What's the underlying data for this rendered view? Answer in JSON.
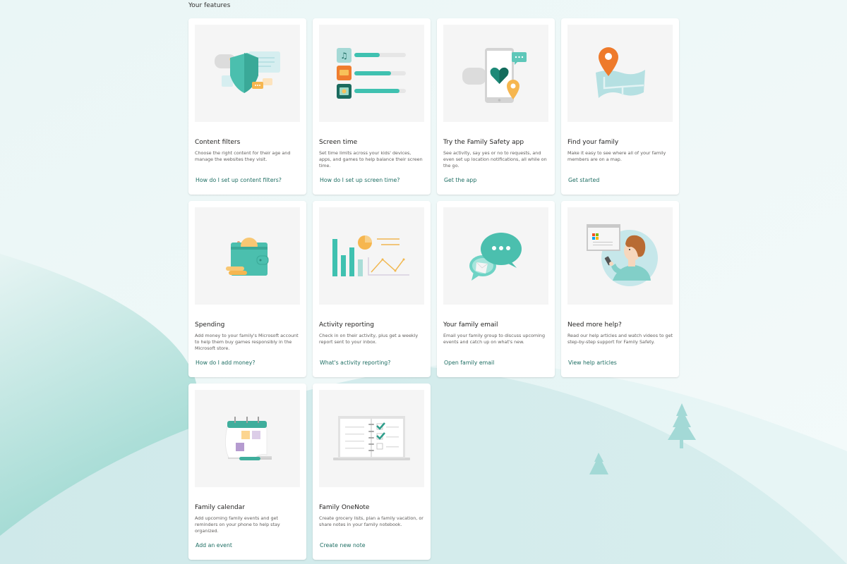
{
  "section_title": "Your features",
  "colors": {
    "accent_teal": "#3fc1b0",
    "link": "#1e6e63",
    "orange": "#f07c2a",
    "yellow": "#f8c25a",
    "background": "#eef7f7"
  },
  "features": [
    {
      "title": "Content filters",
      "description": "Choose the right content for their age and manage the websites they visit.",
      "link": "How do I set up content filters?",
      "illustration": "shield-icon"
    },
    {
      "title": "Screen time",
      "description": "Set time limits across your kids' devices, apps, and games to help balance their screen time.",
      "link": "How do I set up screen time?",
      "illustration": "screen-time-bars-icon"
    },
    {
      "title": "Try the Family Safety app",
      "description": "See activity, say yes or no to requests, and even set up location notifications, all while on the go.",
      "link": "Get the app",
      "illustration": "phone-heart-icon"
    },
    {
      "title": "Find your family",
      "description": "Make it easy to see where all of your family members are on a map.",
      "link": "Get started",
      "illustration": "map-pin-icon"
    },
    {
      "title": "Spending",
      "description": "Add money to your family's Microsoft account to help them buy games responsibly in the Microsoft store.",
      "link": "How do I add money?",
      "illustration": "wallet-icon"
    },
    {
      "title": "Activity reporting",
      "description": "Check in on their activity, plus get a weekly report sent to your inbox.",
      "link": "What's activity reporting?",
      "illustration": "chart-report-icon"
    },
    {
      "title": "Your family email",
      "description": "Email your family group to discuss upcoming events and catch up on what's new.",
      "link": "Open family email",
      "illustration": "chat-email-icon"
    },
    {
      "title": "Need more help?",
      "description": "Read our help articles and watch videos to get step-by-step support for Family Safety.",
      "link": "View help articles",
      "illustration": "help-person-icon"
    },
    {
      "title": "Family calendar",
      "description": "Add upcoming family events and get reminders on your phone to help stay organized.",
      "link": "Add an event",
      "illustration": "calendar-icon"
    },
    {
      "title": "Family OneNote",
      "description": "Create grocery lists, plan a family vacation, or share notes in your family notebook.",
      "link": "Create new note",
      "illustration": "notebook-checklist-icon"
    }
  ]
}
